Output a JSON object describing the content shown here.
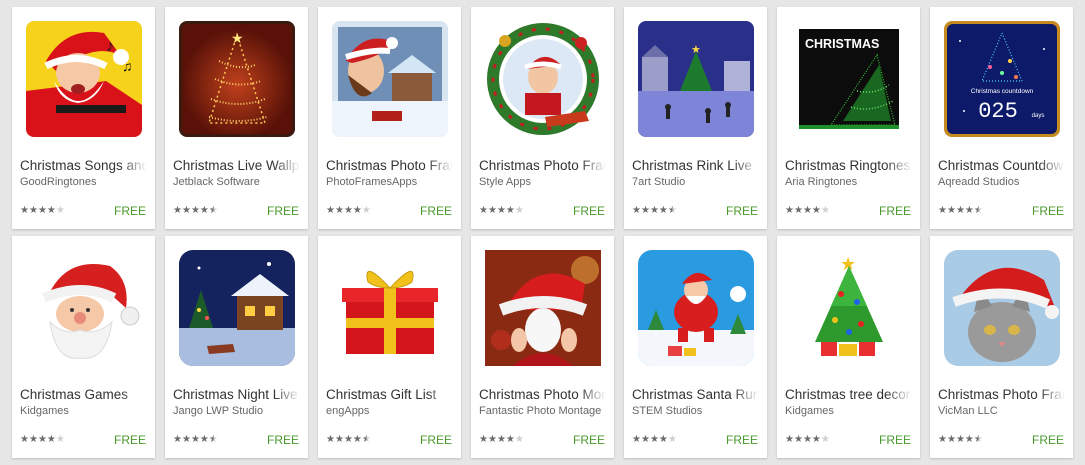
{
  "accent": {
    "price_color": "#4a9a2e",
    "star_color": "#6b6b6b"
  },
  "apps": [
    {
      "title": "Christmas Songs and",
      "developer": "GoodRingtones",
      "rating": 4,
      "price": "FREE",
      "icon": "santa-singing-icon"
    },
    {
      "title": "Christmas Live Wallpaper",
      "developer": "Jetblack Software",
      "rating": 4.5,
      "price": "FREE",
      "icon": "glowing-tree-icon"
    },
    {
      "title": "Christmas Photo Frames",
      "developer": "PhotoFramesApps",
      "rating": 4,
      "price": "FREE",
      "icon": "photo-frame-woman-icon"
    },
    {
      "title": "Christmas Photo Frames",
      "developer": "Style Apps",
      "rating": 4,
      "price": "FREE",
      "icon": "photo-frame-child-icon"
    },
    {
      "title": "Christmas Rink Live",
      "developer": "7art Studio",
      "rating": 4.5,
      "price": "FREE",
      "icon": "skating-rink-icon"
    },
    {
      "title": "Christmas Ringtones",
      "developer": "Aria Ringtones",
      "rating": 4,
      "price": "FREE",
      "icon": "christmas-ringtone-icon"
    },
    {
      "title": "Christmas Countdown",
      "developer": "Aqreadd Studios",
      "rating": 4.5,
      "price": "FREE",
      "icon": "countdown-tree-icon",
      "countdown_label": "Christmas countdown",
      "countdown_value": "025",
      "countdown_unit": "days"
    },
    {
      "title": "Christmas Games",
      "developer": "Kidgames",
      "rating": 4,
      "price": "FREE",
      "icon": "santa-face-icon"
    },
    {
      "title": "Christmas Night Live",
      "developer": "Jango LWP Studio",
      "rating": 4.5,
      "price": "FREE",
      "icon": "snowy-cabin-icon"
    },
    {
      "title": "Christmas Gift List",
      "developer": "engApps",
      "rating": 4.5,
      "price": "FREE",
      "icon": "gift-box-icon"
    },
    {
      "title": "Christmas Photo Montage",
      "developer": "Fantastic Photo Montage",
      "rating": 4,
      "price": "FREE",
      "icon": "santa-hat-photo-icon"
    },
    {
      "title": "Christmas Santa Run",
      "developer": "STEM Studios",
      "rating": 4,
      "price": "FREE",
      "icon": "running-santa-icon"
    },
    {
      "title": "Christmas tree decoration",
      "developer": "Kidgames",
      "rating": 4,
      "price": "FREE",
      "icon": "decorated-tree-icon"
    },
    {
      "title": "Christmas Photo Frames",
      "developer": "VicMan LLC",
      "rating": 4.5,
      "price": "FREE",
      "icon": "cat-santa-hat-icon"
    }
  ],
  "ringtone_icon_text": "CHRISTMAS"
}
